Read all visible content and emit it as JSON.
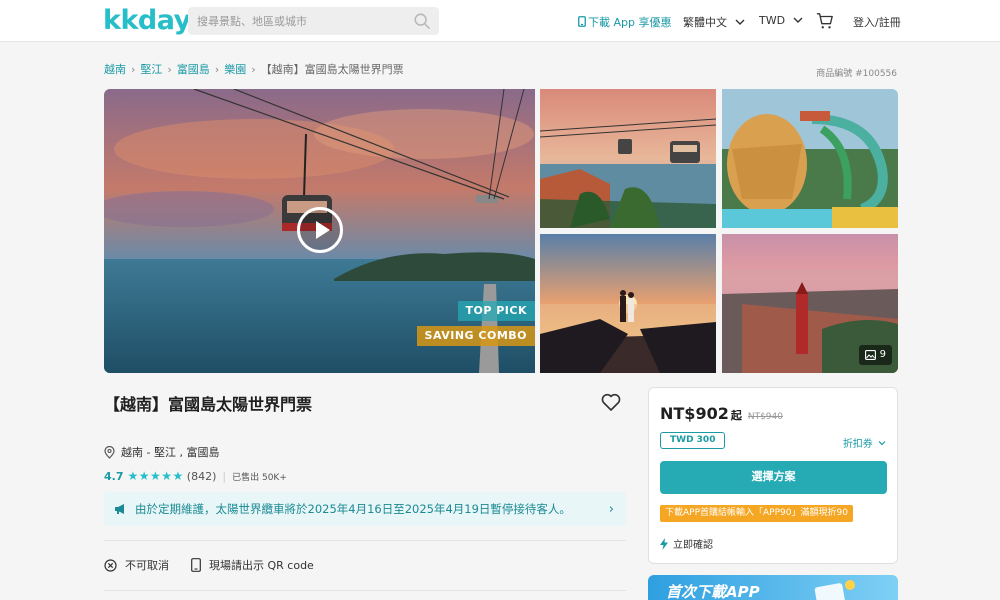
{
  "header": {
    "logo": "kkday",
    "search_placeholder": "搜尋景點、地區或城市",
    "download_app": "下載 App 享優惠",
    "language": "繁體中文",
    "currency": "TWD",
    "login": "登入/註冊"
  },
  "breadcrumb": {
    "items": [
      "越南",
      "堅江",
      "富國島",
      "樂園"
    ],
    "current": "【越南】富國島太陽世界門票"
  },
  "product_id": "商品編號 #100556",
  "gallery": {
    "tag_top": "TOP PICK",
    "tag_combo": "SAVING COMBO",
    "photo_count": "9"
  },
  "product": {
    "title": "【越南】富國島太陽世界門票",
    "location": "越南 - 堅江 , 富國島",
    "rating": "4.7",
    "stars": "★★★★★",
    "review_count": "(842)",
    "sold": "已售出 50K+",
    "notice": "由於定期維護，太陽世界纜車將於2025年4月16日至2025年4月19日暫停接待客人。",
    "features": [
      "不可取消",
      "現場請出示 QR code"
    ]
  },
  "booking": {
    "price": "NT$902",
    "price_suffix": "起",
    "old_price": "NT$940",
    "coupon": "TWD 300",
    "discount_link": "折扣券",
    "choose_button": "選擇方案",
    "promo": "下載APP首購結帳輸入「APP90」滿額現折90",
    "instant_confirm": "立即確認"
  },
  "app_banner": {
    "text": "首次下載APP"
  },
  "colors": {
    "brand": "#26bec9",
    "brand_dark": "#1a9aa5",
    "promo": "#f5a623"
  },
  "icons": [
    "search-icon",
    "phone-icon",
    "chevron-down-icon",
    "cart-icon",
    "play-icon",
    "photos-icon",
    "heart-icon",
    "location-pin-icon",
    "megaphone-icon",
    "chevron-right-icon",
    "cancel-icon",
    "phone-qr-icon",
    "lightning-icon"
  ]
}
